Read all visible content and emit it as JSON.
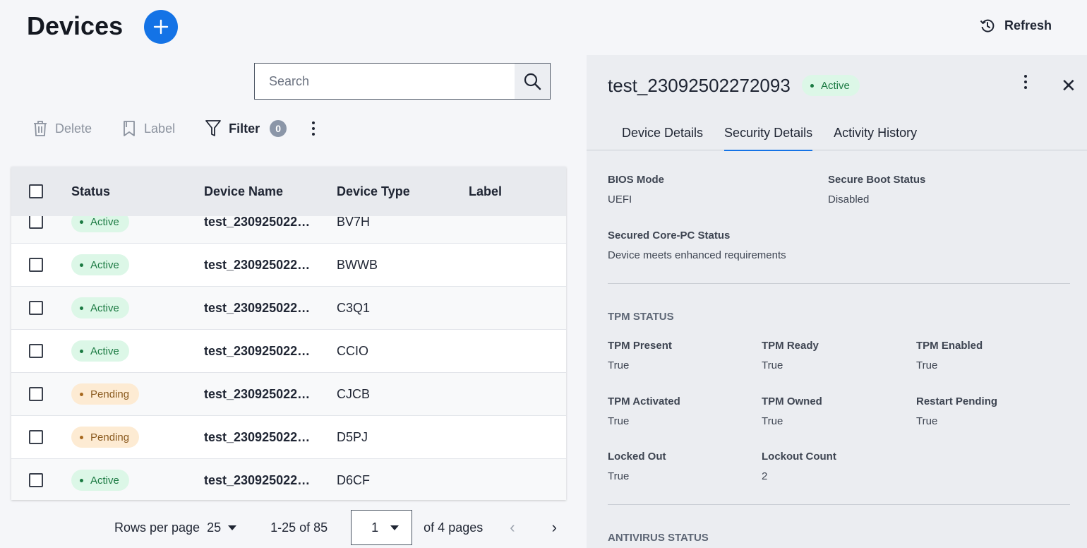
{
  "header": {
    "title": "Devices",
    "refresh_label": "Refresh"
  },
  "search": {
    "placeholder": "Search"
  },
  "toolbar": {
    "delete_label": "Delete",
    "label_label": "Label",
    "filter_label": "Filter",
    "filter_count": "0"
  },
  "table": {
    "columns": {
      "status": "Status",
      "name": "Device Name",
      "type": "Device Type",
      "label": "Label"
    },
    "rows": [
      {
        "status": "Active",
        "name": "test_230925022…",
        "type": "BV7H",
        "label": ""
      },
      {
        "status": "Active",
        "name": "test_230925022…",
        "type": "BWWB",
        "label": ""
      },
      {
        "status": "Active",
        "name": "test_230925022…",
        "type": "C3Q1",
        "label": ""
      },
      {
        "status": "Active",
        "name": "test_230925022…",
        "type": "CCIO",
        "label": ""
      },
      {
        "status": "Pending",
        "name": "test_230925022…",
        "type": "CJCB",
        "label": ""
      },
      {
        "status": "Pending",
        "name": "test_230925022…",
        "type": "D5PJ",
        "label": ""
      },
      {
        "status": "Active",
        "name": "test_230925022…",
        "type": "D6CF",
        "label": ""
      }
    ]
  },
  "pagination": {
    "rows_per_page_label": "Rows per page",
    "rows_per_page": "25",
    "range": "1-25 of 85",
    "current_page": "1",
    "total_pages_text": "of 4 pages"
  },
  "panel": {
    "device_name": "test_23092502272093",
    "status": "Active",
    "tabs": [
      "Device Details",
      "Security Details",
      "Activity History"
    ],
    "selected_tab": "Security Details",
    "bios_mode_label": "BIOS Mode",
    "bios_mode_value": "UEFI",
    "secure_boot_label": "Secure Boot Status",
    "secure_boot_value": "Disabled",
    "secured_core_label": "Secured Core-PC Status",
    "secured_core_value": "Device meets enhanced requirements",
    "tpm_section_title": "TPM STATUS",
    "tpm_fields": [
      {
        "label": "TPM Present",
        "value": "True"
      },
      {
        "label": "TPM Ready",
        "value": "True"
      },
      {
        "label": "TPM Enabled",
        "value": "True"
      },
      {
        "label": "TPM Activated",
        "value": "True"
      },
      {
        "label": "TPM Owned",
        "value": "True"
      },
      {
        "label": "Restart Pending",
        "value": "True"
      },
      {
        "label": "Locked Out",
        "value": "True"
      },
      {
        "label": "Lockout Count",
        "value": "2"
      }
    ],
    "antivirus_section_title": "ANTIVIRUS STATUS"
  },
  "colors": {
    "primary": "#1473e6",
    "active_bg": "#dcf7e7",
    "active_text": "#1b7a42",
    "pending_bg": "#fdebd3",
    "pending_text": "#8a5a1f"
  }
}
